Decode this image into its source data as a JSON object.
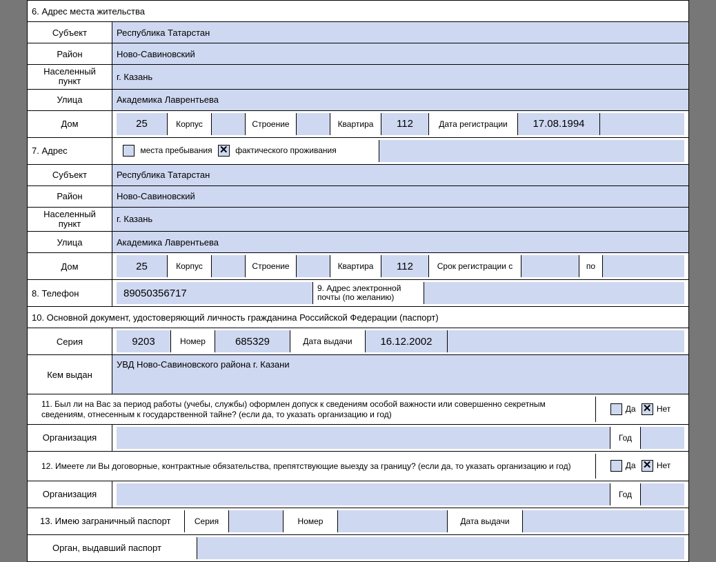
{
  "sec6": {
    "title": "6. Адрес места жительства",
    "subject_label": "Субъект",
    "subject": "Республика Татарстан",
    "district_label": "Район",
    "district": "Ново-Савиновский",
    "city_label": "Населенный пункт",
    "city": "г. Казань",
    "street_label": "Улица",
    "street": "Академика Лаврентьева",
    "house_label": "Дом",
    "house": "25",
    "korpus_label": "Корпус",
    "korpus": "",
    "building_label": "Строение",
    "building": "",
    "flat_label": "Квартира",
    "flat": "112",
    "regdate_label": "Дата регистрации",
    "regdate": "17.08.1994"
  },
  "sec7": {
    "title": "7. Адрес",
    "opt1": "места пребывания",
    "opt2": "фактического проживания",
    "subject_label": "Субъект",
    "subject": "Республика Татарстан",
    "district_label": "Район",
    "district": "Ново-Савиновский",
    "city_label": "Населенный пункт",
    "city": "г. Казань",
    "street_label": "Улица",
    "street": "Академика Лаврентьева",
    "house_label": "Дом",
    "house": "25",
    "korpus_label": "Корпус",
    "korpus": "",
    "building_label": "Строение",
    "building": "",
    "flat_label": "Квартира",
    "flat": "112",
    "term_label": "Срок регистрации с",
    "term_to": "по"
  },
  "sec8": {
    "label": "8. Телефон",
    "value": "89050356717"
  },
  "sec9": {
    "label": "9. Адрес электронной почты (по желанию)",
    "value": ""
  },
  "sec10": {
    "title": "10. Основной документ, удостоверяющий личность гражданина Российской Федерации (паспорт)",
    "series_label": "Серия",
    "series": "9203",
    "number_label": "Номер",
    "number": "685329",
    "date_label": "Дата выдачи",
    "date": "16.12.2002",
    "issued_label": "Кем выдан",
    "issued": "УВД Ново-Савиновского района г. Казани"
  },
  "sec11": {
    "text": "11. Был ли на Вас за период работы (учебы, службы) оформлен допуск к сведениям особой важности или совершенно секретным сведениям, отнесенным к государственной тайне? (если да, то указать организацию и год)",
    "yes": "Да",
    "no": "Нет",
    "org_label": "Организация",
    "year_label": "Год"
  },
  "sec12": {
    "text": "12. Имеете ли Вы договорные, контрактные обязательства, препятствующие выезду за границу? (если да, то указать организацию и год)",
    "yes": "Да",
    "no": "Нет",
    "org_label": "Организация",
    "year_label": "Год"
  },
  "sec13": {
    "title": "13. Имею заграничный паспорт",
    "series_label": "Серия",
    "number_label": "Номер",
    "date_label": "Дата выдачи",
    "organ_label": "Орган, выдавший паспорт"
  }
}
